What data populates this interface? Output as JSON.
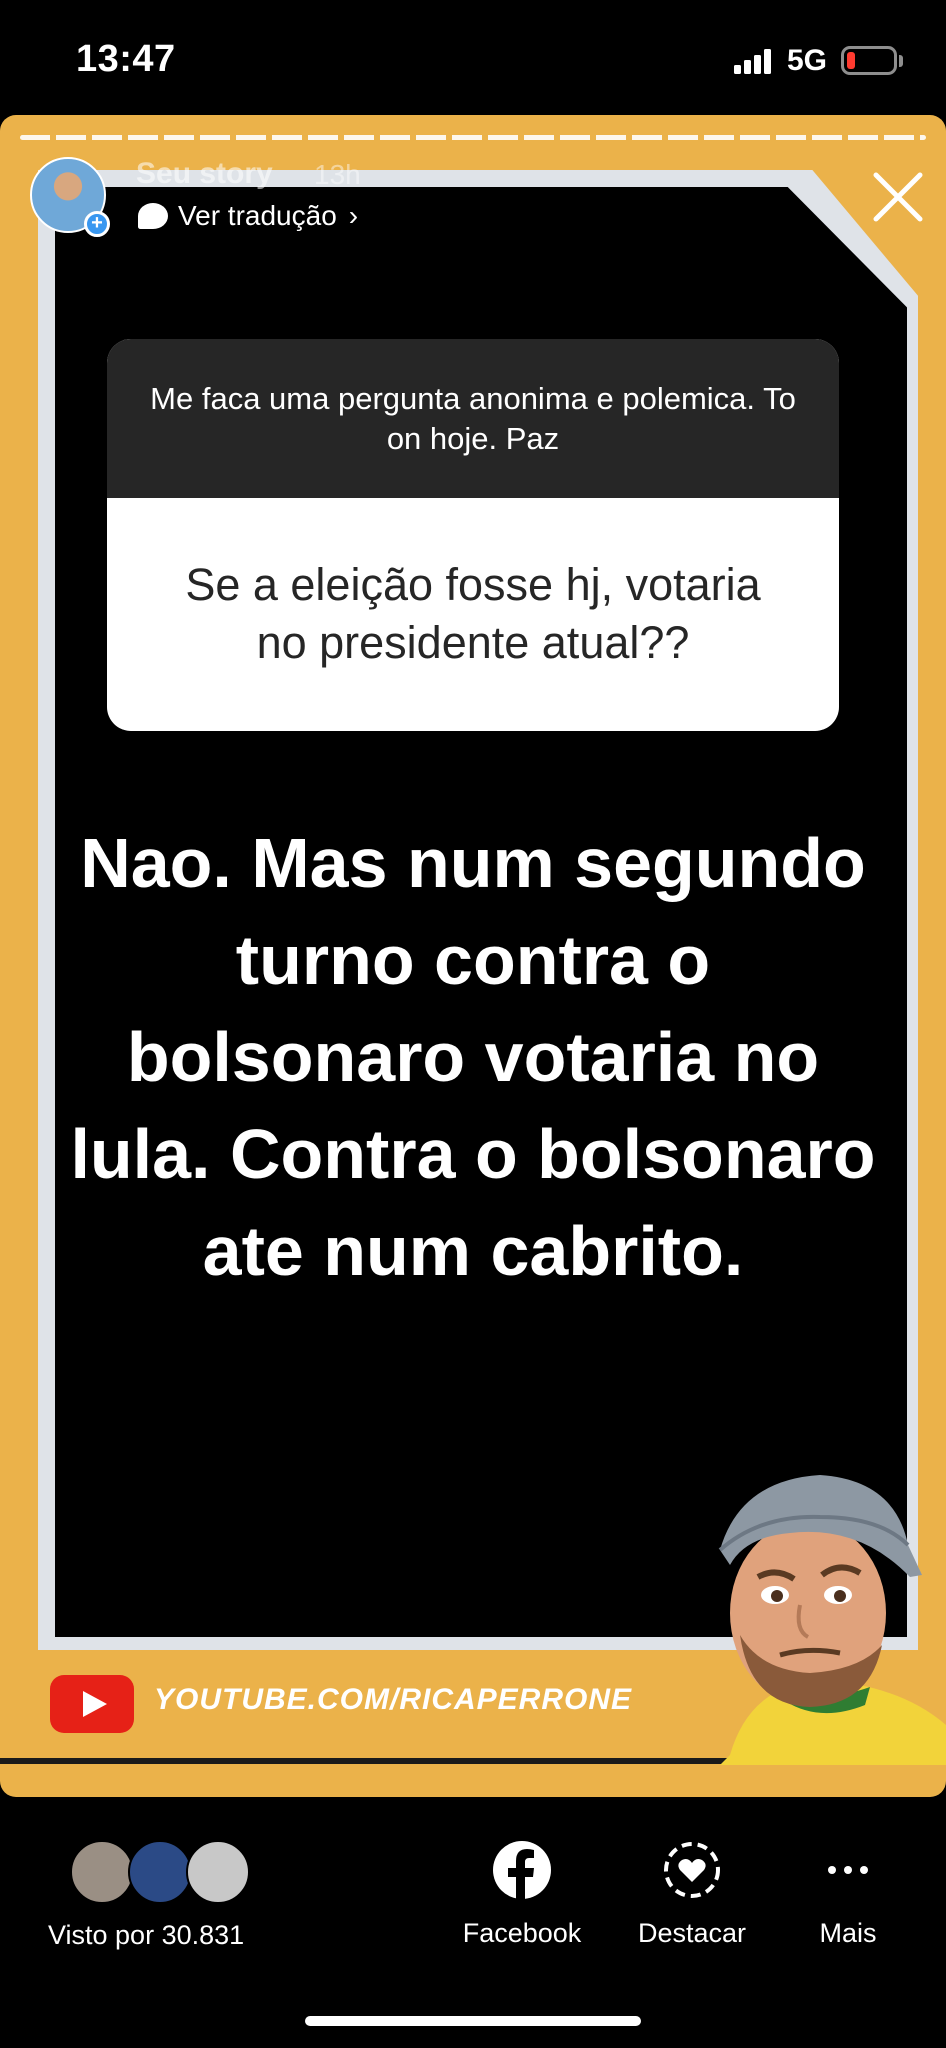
{
  "status_bar": {
    "time": "13:47",
    "network": "5G",
    "battery_level": 0.12,
    "icons": [
      "signal-icon",
      "battery-icon"
    ]
  },
  "story": {
    "username": "Seu story",
    "time_ago": "13h",
    "translate_label": "Ver tradução",
    "question_prompt": "Me faca uma pergunta anonima e polemica. To on hoje. Paz",
    "question_text": "Se a eleição fosse hj, votaria no presidente atual??",
    "answer_text": "Nao. Mas num segundo turno contra o bolsonaro votaria no lula. Contra o bolsonaro ate num cabrito.",
    "channel_url": "YOUTUBE.COM/RICAPERRONE",
    "progress_segments": 20,
    "colors": {
      "frame": "#ebb24a",
      "background": "#000000",
      "youtube": "#e62117"
    }
  },
  "footer": {
    "seen_by": "Visto por 30.831",
    "actions": [
      {
        "label": "Facebook",
        "icon": "facebook-icon"
      },
      {
        "label": "Destacar",
        "icon": "highlight-icon"
      },
      {
        "label": "Mais",
        "icon": "more-icon"
      }
    ]
  }
}
